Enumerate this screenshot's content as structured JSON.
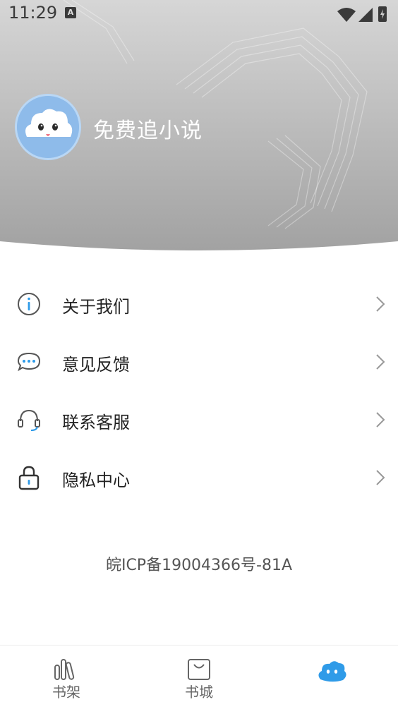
{
  "status_bar": {
    "time": "11:29",
    "notification_badge": "A"
  },
  "profile": {
    "title": "免费追小说"
  },
  "menu": {
    "items": [
      {
        "label": "关于我们",
        "icon": "info-icon"
      },
      {
        "label": "意见反馈",
        "icon": "chat-bubble-icon"
      },
      {
        "label": "联系客服",
        "icon": "headset-icon"
      },
      {
        "label": "隐私中心",
        "icon": "lock-icon"
      }
    ]
  },
  "footer": {
    "icp": "皖ICP备19004366号-81A"
  },
  "tabbar": {
    "tabs": [
      {
        "label": "书架",
        "icon": "bookshelf-icon"
      },
      {
        "label": "书城",
        "icon": "shopping-bag-icon"
      },
      {
        "label": "",
        "icon": "cloud-mascot-icon",
        "active": true
      }
    ]
  },
  "colors": {
    "header_gradient_top": "#d8d8d8",
    "header_gradient_bottom": "#a3a3a3",
    "avatar": "#8fbbe9",
    "active_tab": "#2f9be8",
    "text_primary": "#222222"
  }
}
